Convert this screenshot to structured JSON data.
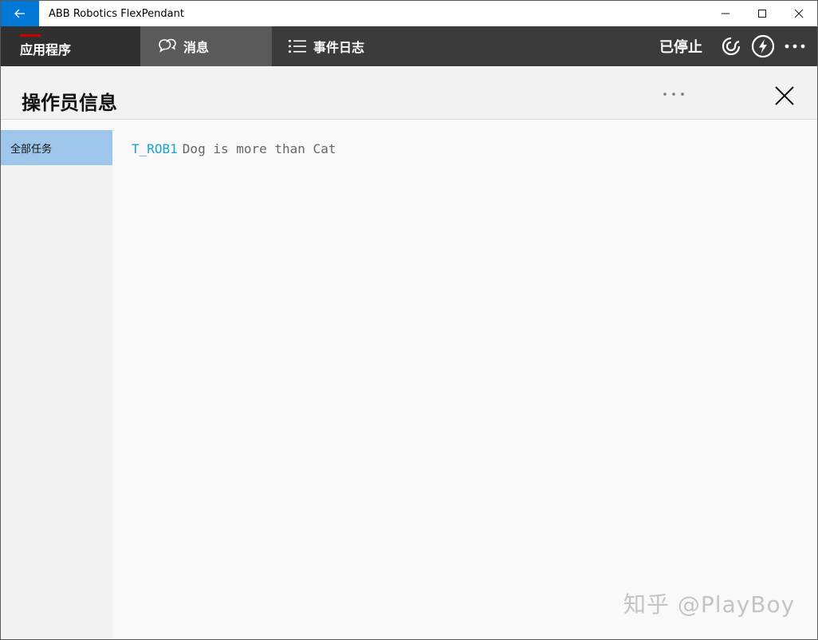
{
  "window": {
    "title": "ABB Robotics FlexPendant"
  },
  "nav": {
    "apps_label": "应用程序",
    "messages_label": "消息",
    "event_log_label": "事件日志",
    "status": "已停止"
  },
  "page": {
    "title": "操作员信息"
  },
  "sidebar": {
    "items": [
      {
        "label": "全部任务",
        "selected": true
      }
    ]
  },
  "messages": [
    {
      "task": "T_ROB1",
      "text": "Dog is more than Cat"
    }
  ],
  "watermark": "知乎 @PlayBoy",
  "colors": {
    "accent": "#0078d7",
    "nav_bg": "#3b3b3b",
    "selected_tab": "#5a5a5a",
    "sidebar_selected": "#9ec6ea",
    "task_color": "#1aa3d0",
    "alert_red": "#d40000"
  },
  "icons": {
    "back": "back-arrow-icon",
    "minimize": "minimize-icon",
    "maximize": "maximize-icon",
    "close": "close-icon",
    "messages": "chat-bubbles-icon",
    "event_log": "list-icon",
    "motor": "motor-swirl-icon",
    "power": "lightning-icon",
    "more": "more-dots-icon"
  }
}
